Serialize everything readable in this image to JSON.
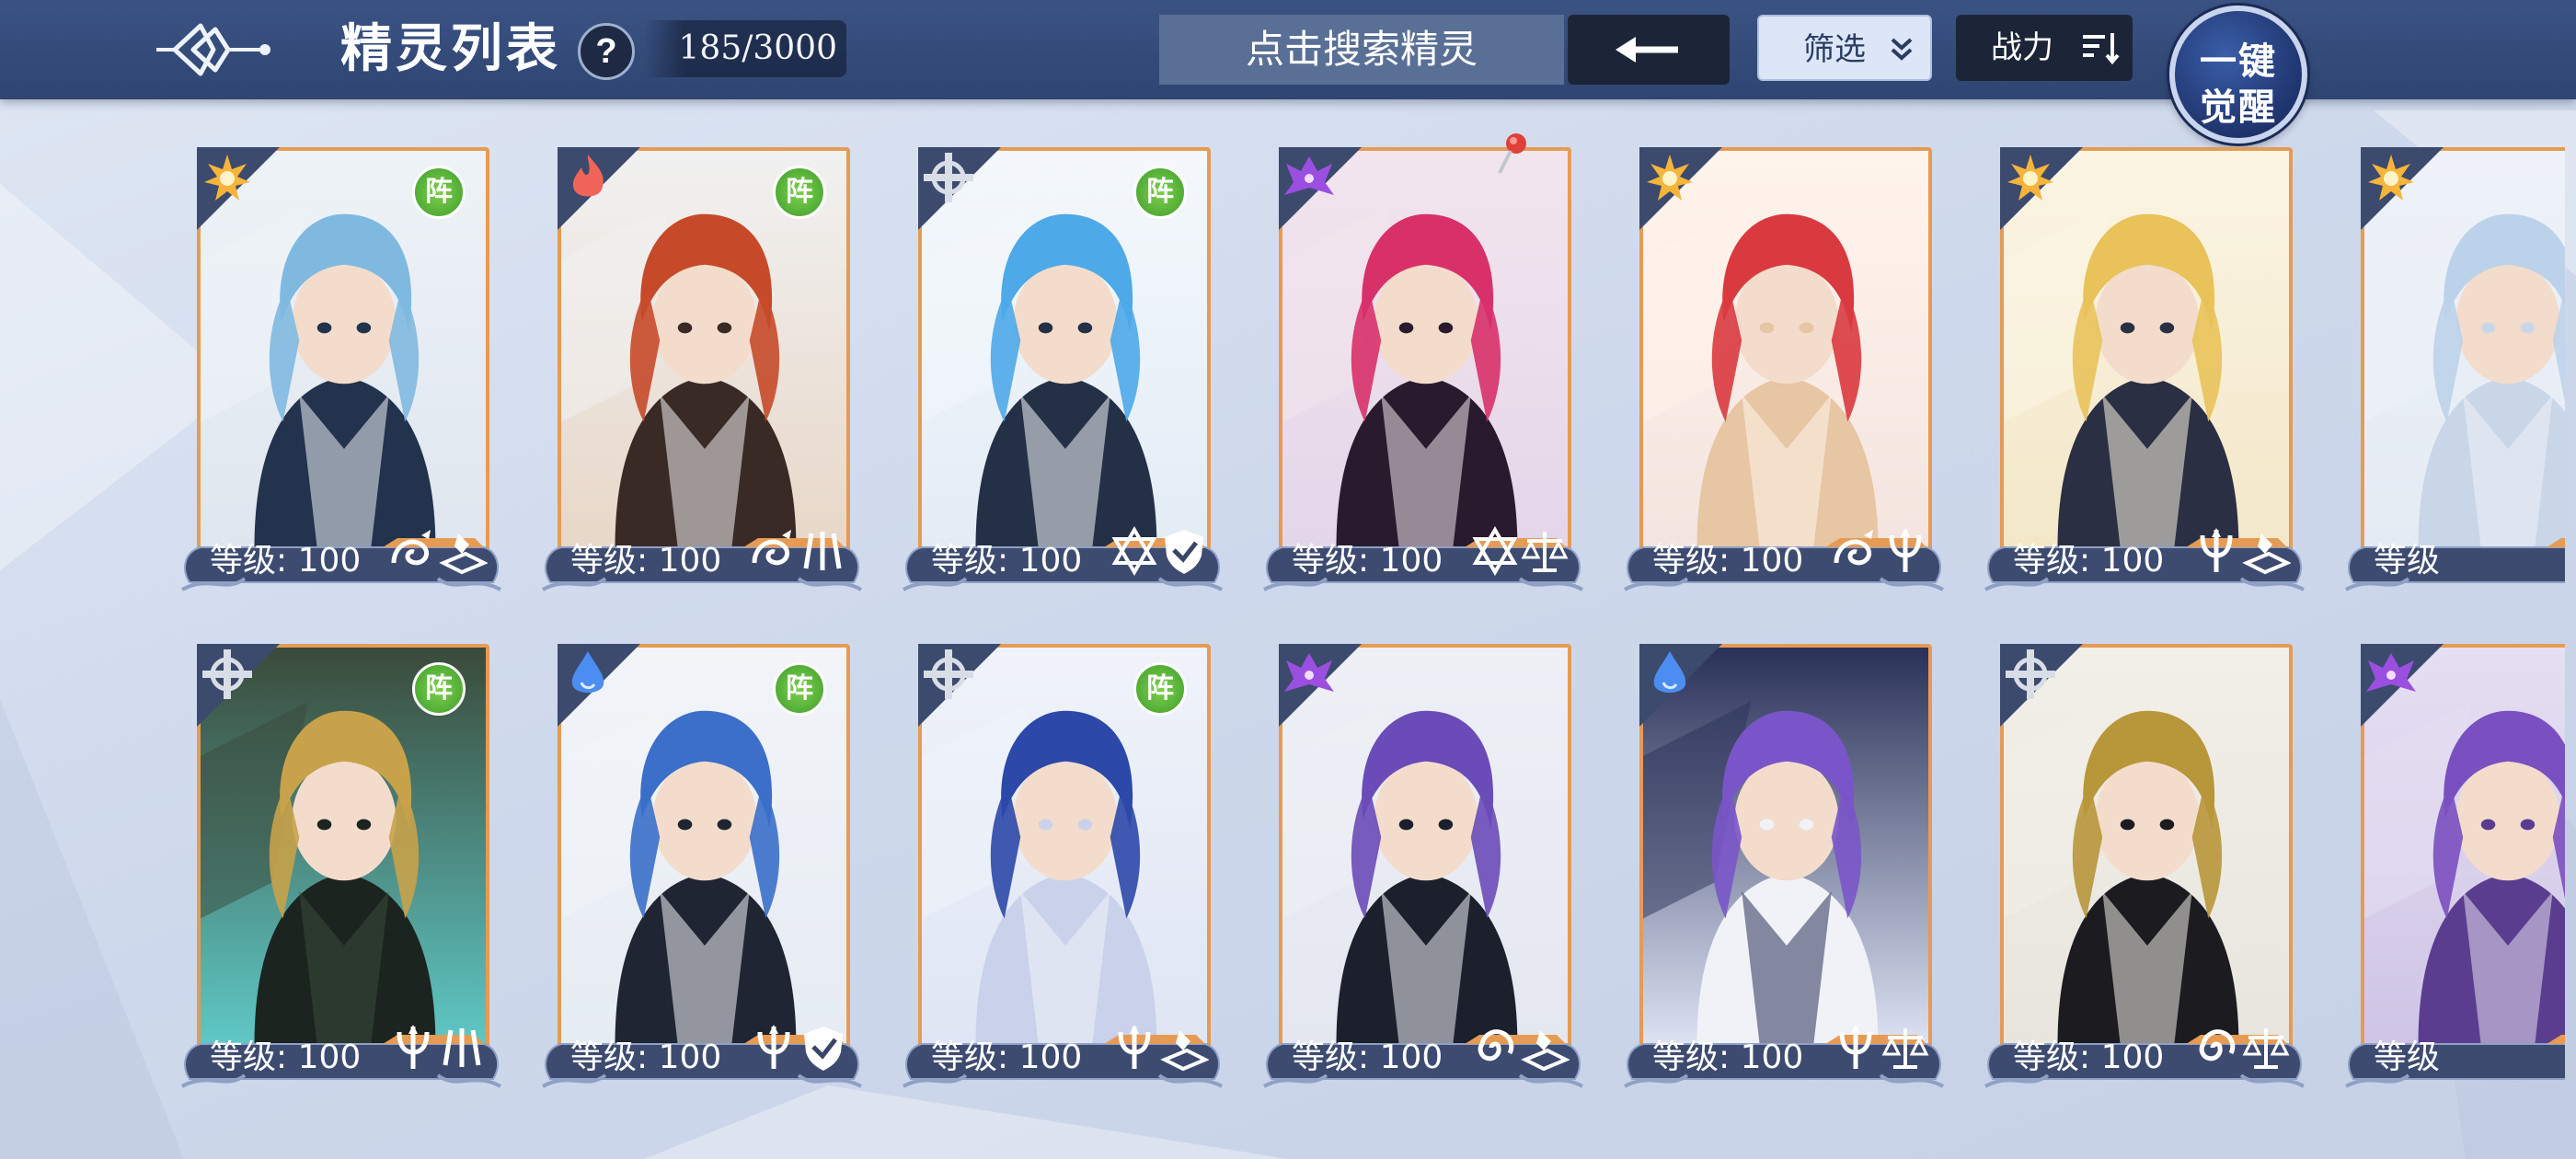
{
  "header": {
    "title": "精灵列表",
    "help_label": "?",
    "count": "185/3000",
    "search_placeholder": "点击搜索精灵",
    "filter_label": "筛选",
    "sort_label": "战力",
    "awaken_line1": "一键",
    "awaken_line2": "觉醒"
  },
  "colors": {
    "topbar": "#2f4572",
    "card_border": "#e59b54",
    "formation_badge": "#3f9e2a",
    "light": "#f6b53a",
    "fire": "#f0645a",
    "mech": "#d9dde6",
    "dark": "#9b4fe0",
    "water": "#4b8df0"
  },
  "level_prefix": "等级",
  "cards": [
    {
      "element": "light-icon",
      "formation": "阵",
      "level": "等级: 100",
      "skills": [
        "dragon-icon",
        "tome-icon"
      ],
      "art": [
        "#dfe6ef",
        "#7fb9e0",
        "#23324d",
        "#eef3f7"
      ]
    },
    {
      "element": "fire-icon",
      "formation": "阵",
      "level": "等级: 100",
      "skills": [
        "dragon-icon",
        "claw-icon"
      ],
      "art": [
        "#e8d7c8",
        "#c64a2a",
        "#3a2a26",
        "#f1f1f1"
      ]
    },
    {
      "element": "mech-icon",
      "formation": "阵",
      "level": "等级: 100",
      "skills": [
        "star-of-david-icon",
        "shield-icon"
      ],
      "art": [
        "#e3ecf6",
        "#4ea9e8",
        "#243046",
        "#f4f8fc"
      ]
    },
    {
      "element": "dark-icon",
      "formation": "",
      "level": "等级: 100",
      "skills": [
        "star-of-david-icon",
        "scales-icon"
      ],
      "art": [
        "#e4d6e9",
        "#d8316a",
        "#2a1a2e",
        "#f3e5ee"
      ],
      "pinned": true
    },
    {
      "element": "light-icon",
      "formation": "",
      "level": "等级: 100",
      "skills": [
        "dragon-icon",
        "trident-icon"
      ],
      "art": [
        "#f4e4df",
        "#d93a3f",
        "#e6c6a3",
        "#fff4ec"
      ]
    },
    {
      "element": "light-icon",
      "formation": "",
      "level": "等级: 100",
      "skills": [
        "trident-icon",
        "tome-icon"
      ],
      "art": [
        "#f3e7c8",
        "#e9c25a",
        "#2b2f43",
        "#fbf5e4"
      ]
    },
    {
      "element": "light-icon",
      "formation": "",
      "level": "等级",
      "skills": [],
      "art": [
        "#e5ebf4",
        "#bcd2ea",
        "#c9d6e8",
        "#eef2f8"
      ],
      "partial": true
    },
    {
      "element": "mech-icon",
      "formation": "阵",
      "level": "等级: 100",
      "skills": [
        "trident-icon",
        "claw-icon"
      ],
      "art": [
        "#5fc8c6",
        "#c8a24a",
        "#1c2420",
        "#3a4a3a"
      ]
    },
    {
      "element": "water-icon",
      "formation": "阵",
      "level": "等级: 100",
      "skills": [
        "trident-icon",
        "shield-icon"
      ],
      "art": [
        "#e6ecf3",
        "#3b6fc9",
        "#1f2533",
        "#f2f4f8"
      ]
    },
    {
      "element": "mech-icon",
      "formation": "阵",
      "level": "等级: 100",
      "skills": [
        "trident-icon",
        "tome-icon"
      ],
      "art": [
        "#dfe5f4",
        "#2c48a8",
        "#c9d2ea",
        "#f0f3fa"
      ]
    },
    {
      "element": "dark-icon",
      "formation": "",
      "level": "等级: 100",
      "skills": [
        "spiral-icon",
        "tome-icon"
      ],
      "art": [
        "#e4e7f0",
        "#6a4bb8",
        "#1c1f2c",
        "#eef0f6"
      ]
    },
    {
      "element": "water-icon",
      "formation": "",
      "level": "等级: 100",
      "skills": [
        "trident-icon",
        "scales-icon"
      ],
      "art": [
        "#dde3f3",
        "#7a55c9",
        "#f0f2f8",
        "#2a3158"
      ]
    },
    {
      "element": "mech-icon",
      "formation": "",
      "level": "等级: 100",
      "skills": [
        "spiral-icon",
        "scales-icon"
      ],
      "art": [
        "#e8e5de",
        "#b8963a",
        "#1b1b20",
        "#f2efe8"
      ]
    },
    {
      "element": "dark-icon",
      "formation": "",
      "level": "等级",
      "skills": [],
      "art": [
        "#cfc4e6",
        "#7a4fbf",
        "#5a3d8f",
        "#e6dff2"
      ],
      "partial": true
    }
  ]
}
